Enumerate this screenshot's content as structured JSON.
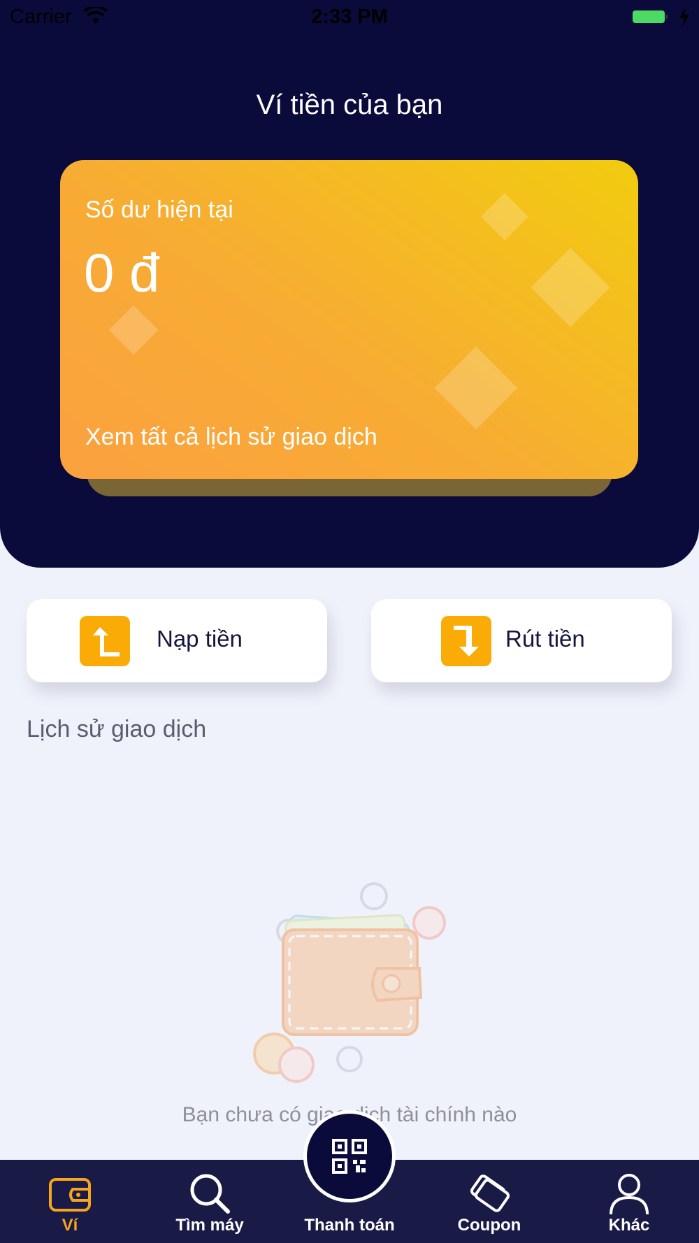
{
  "status_bar": {
    "carrier": "Carrier",
    "time": "2:33 PM",
    "battery_color": "#4cd964"
  },
  "header": {
    "title": "Ví tiền của bạn",
    "background_color": "#0b0b3b"
  },
  "balance_card": {
    "label": "Số dư hiện tại",
    "balance": "0 đ",
    "history_link": "Xem tất cả lịch sử giao dịch",
    "gradient_colors": [
      "#fba140",
      "#f2cc0f"
    ]
  },
  "actions": {
    "deposit_label": "Nạp tiền",
    "withdraw_label": "Rút tiền",
    "icon_color": "#fbab06"
  },
  "history": {
    "section_title": "Lịch sử giao dịch",
    "empty_message": "Bạn chưa có giao dịch tài chính nào"
  },
  "bottom_nav": {
    "items": [
      {
        "label": "Ví",
        "icon": "wallet-icon",
        "active": true
      },
      {
        "label": "Tìm máy",
        "icon": "search-icon",
        "active": false
      },
      {
        "label": "Thanh toán",
        "icon": "qr-code-icon",
        "active": false
      },
      {
        "label": "Coupon",
        "icon": "coupon-icon",
        "active": false
      },
      {
        "label": "Khác",
        "icon": "user-icon",
        "active": false
      }
    ],
    "active_color": "#f7a51c",
    "background_color": "#1a1a47"
  }
}
